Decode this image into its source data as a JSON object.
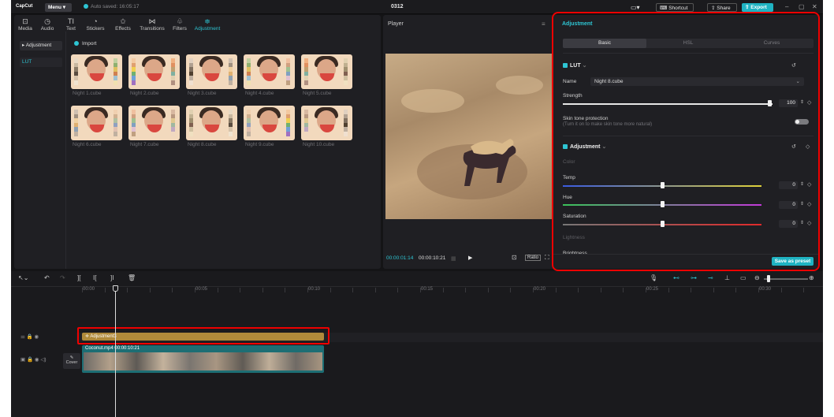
{
  "app": {
    "logo": "CapCut",
    "menu": "Menu",
    "autosave": "Auto saved: 16:05:17",
    "project": "0312",
    "shortcut": "Shortcut",
    "share": "Share",
    "export": "Export"
  },
  "toolbar": [
    {
      "label": "Media",
      "icon": "media-icon"
    },
    {
      "label": "Audio",
      "icon": "audio-icon"
    },
    {
      "label": "Text",
      "icon": "text-icon"
    },
    {
      "label": "Stickers",
      "icon": "stickers-icon"
    },
    {
      "label": "Effects",
      "icon": "effects-icon"
    },
    {
      "label": "Transitions",
      "icon": "transitions-icon"
    },
    {
      "label": "Filters",
      "icon": "filters-icon"
    },
    {
      "label": "Adjustment",
      "icon": "adjustment-icon"
    }
  ],
  "sidebar": {
    "adjustment": "Adjustment",
    "lut": "LUT"
  },
  "import": "Import",
  "luts": [
    "Night 1.cube",
    "Night 2.cube",
    "Night 3.cube",
    "Night 4.cube",
    "Night 5.cube",
    "Night 6.cube",
    "Night 7.cube",
    "Night 8.cube",
    "Night 9.cube",
    "Night 10.cube"
  ],
  "player": {
    "title": "Player",
    "current": "00:00:01:14",
    "total": "00:00:10:21",
    "ratio": "Ratio"
  },
  "adjust_panel": {
    "title": "Adjustment",
    "tabs": [
      "Basic",
      "HSL",
      "Curves"
    ],
    "lut": {
      "header": "LUT",
      "name_label": "Name",
      "name_value": "Night 8.cube",
      "strength_label": "Strength",
      "strength_value": "100",
      "skin_label": "Skin tone protection",
      "skin_hint": "(Turn it on to make skin tone more natural)"
    },
    "adjustment": {
      "header": "Adjustment",
      "color": "Color",
      "temp_label": "Temp",
      "temp_value": "0",
      "hue_label": "Hue",
      "hue_value": "0",
      "sat_label": "Saturation",
      "sat_value": "0",
      "lightness": "Lightness",
      "brightness": "Brightness"
    },
    "save_preset": "Save as preset"
  },
  "timeline": {
    "ruler": [
      "00:00",
      "00:05",
      "00:10",
      "00:15",
      "00:20",
      "00:25",
      "00:30"
    ],
    "adj_clip": "Adjustment3",
    "video_clip": "Coconut.mp4",
    "video_dur": "00:00:10:21",
    "cover": "Cover"
  },
  "colors": {
    "accent": "#2ec5d3",
    "highlight": "#e00000",
    "adj_clip": "#b08a3a",
    "video_clip": "#1d6e74"
  }
}
